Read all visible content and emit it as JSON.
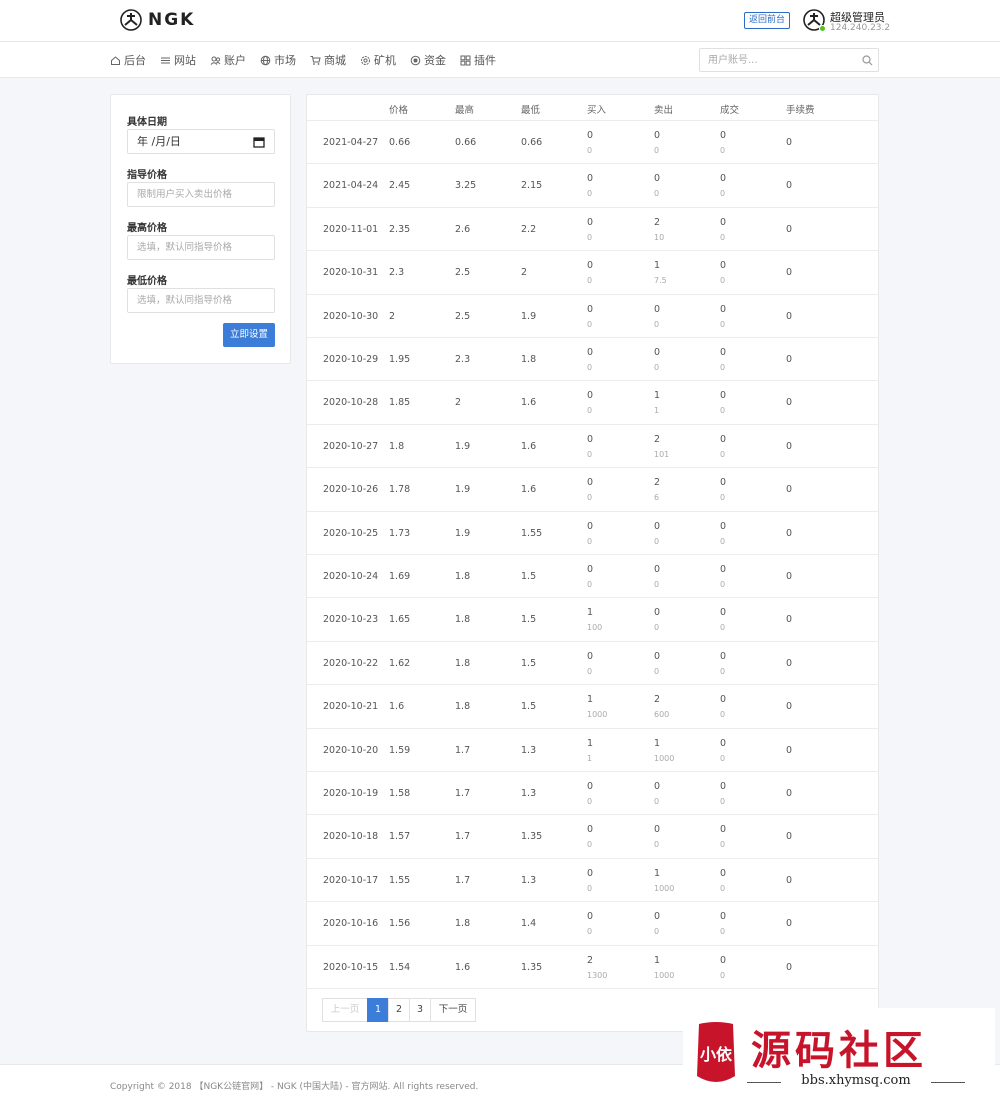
{
  "header": {
    "logo_text": "NGK",
    "back_label": "返回前台",
    "user_name": "超级管理员",
    "user_ip": "124.240.23.2"
  },
  "nav": {
    "items": [
      {
        "label": "后台",
        "icon": "home-icon"
      },
      {
        "label": "网站",
        "icon": "list-icon"
      },
      {
        "label": "账户",
        "icon": "users-icon"
      },
      {
        "label": "市场",
        "icon": "globe-icon"
      },
      {
        "label": "商城",
        "icon": "cart-icon"
      },
      {
        "label": "矿机",
        "icon": "gear-icon"
      },
      {
        "label": "资金",
        "icon": "coin-icon"
      },
      {
        "label": "插件",
        "icon": "grid-icon"
      }
    ],
    "search_placeholder": "用户账号..."
  },
  "form": {
    "date_label": "具体日期",
    "date_value": "年 /月/日",
    "guide_label": "指导价格",
    "guide_placeholder": "限制用户买入卖出价格",
    "max_label": "最高价格",
    "max_placeholder": "选填，默认同指导价格",
    "min_label": "最低价格",
    "min_placeholder": "选填，默认同指导价格",
    "submit_label": "立即设置"
  },
  "table": {
    "columns": [
      "价格",
      "最高",
      "最低",
      "买入",
      "卖出",
      "成交",
      "手续费"
    ],
    "rows": [
      {
        "date": "2021-04-27",
        "price": "0.66",
        "high": "0.66",
        "low": "0.66",
        "buy": "0",
        "buy_sub": "0",
        "sell": "0",
        "sell_sub": "0",
        "deal": "0",
        "deal_sub": "0",
        "fee": "0"
      },
      {
        "date": "2021-04-24",
        "price": "2.45",
        "high": "3.25",
        "low": "2.15",
        "buy": "0",
        "buy_sub": "0",
        "sell": "0",
        "sell_sub": "0",
        "deal": "0",
        "deal_sub": "0",
        "fee": "0"
      },
      {
        "date": "2020-11-01",
        "price": "2.35",
        "high": "2.6",
        "low": "2.2",
        "buy": "0",
        "buy_sub": "0",
        "sell": "2",
        "sell_sub": "10",
        "deal": "0",
        "deal_sub": "0",
        "fee": "0"
      },
      {
        "date": "2020-10-31",
        "price": "2.3",
        "high": "2.5",
        "low": "2",
        "buy": "0",
        "buy_sub": "0",
        "sell": "1",
        "sell_sub": "7.5",
        "deal": "0",
        "deal_sub": "0",
        "fee": "0"
      },
      {
        "date": "2020-10-30",
        "price": "2",
        "high": "2.5",
        "low": "1.9",
        "buy": "0",
        "buy_sub": "0",
        "sell": "0",
        "sell_sub": "0",
        "deal": "0",
        "deal_sub": "0",
        "fee": "0"
      },
      {
        "date": "2020-10-29",
        "price": "1.95",
        "high": "2.3",
        "low": "1.8",
        "buy": "0",
        "buy_sub": "0",
        "sell": "0",
        "sell_sub": "0",
        "deal": "0",
        "deal_sub": "0",
        "fee": "0"
      },
      {
        "date": "2020-10-28",
        "price": "1.85",
        "high": "2",
        "low": "1.6",
        "buy": "0",
        "buy_sub": "0",
        "sell": "1",
        "sell_sub": "1",
        "deal": "0",
        "deal_sub": "0",
        "fee": "0"
      },
      {
        "date": "2020-10-27",
        "price": "1.8",
        "high": "1.9",
        "low": "1.6",
        "buy": "0",
        "buy_sub": "0",
        "sell": "2",
        "sell_sub": "101",
        "deal": "0",
        "deal_sub": "0",
        "fee": "0"
      },
      {
        "date": "2020-10-26",
        "price": "1.78",
        "high": "1.9",
        "low": "1.6",
        "buy": "0",
        "buy_sub": "0",
        "sell": "2",
        "sell_sub": "6",
        "deal": "0",
        "deal_sub": "0",
        "fee": "0"
      },
      {
        "date": "2020-10-25",
        "price": "1.73",
        "high": "1.9",
        "low": "1.55",
        "buy": "0",
        "buy_sub": "0",
        "sell": "0",
        "sell_sub": "0",
        "deal": "0",
        "deal_sub": "0",
        "fee": "0"
      },
      {
        "date": "2020-10-24",
        "price": "1.69",
        "high": "1.8",
        "low": "1.5",
        "buy": "0",
        "buy_sub": "0",
        "sell": "0",
        "sell_sub": "0",
        "deal": "0",
        "deal_sub": "0",
        "fee": "0"
      },
      {
        "date": "2020-10-23",
        "price": "1.65",
        "high": "1.8",
        "low": "1.5",
        "buy": "1",
        "buy_sub": "100",
        "sell": "0",
        "sell_sub": "0",
        "deal": "0",
        "deal_sub": "0",
        "fee": "0"
      },
      {
        "date": "2020-10-22",
        "price": "1.62",
        "high": "1.8",
        "low": "1.5",
        "buy": "0",
        "buy_sub": "0",
        "sell": "0",
        "sell_sub": "0",
        "deal": "0",
        "deal_sub": "0",
        "fee": "0"
      },
      {
        "date": "2020-10-21",
        "price": "1.6",
        "high": "1.8",
        "low": "1.5",
        "buy": "1",
        "buy_sub": "1000",
        "sell": "2",
        "sell_sub": "600",
        "deal": "0",
        "deal_sub": "0",
        "fee": "0"
      },
      {
        "date": "2020-10-20",
        "price": "1.59",
        "high": "1.7",
        "low": "1.3",
        "buy": "1",
        "buy_sub": "1",
        "sell": "1",
        "sell_sub": "1000",
        "deal": "0",
        "deal_sub": "0",
        "fee": "0"
      },
      {
        "date": "2020-10-19",
        "price": "1.58",
        "high": "1.7",
        "low": "1.3",
        "buy": "0",
        "buy_sub": "0",
        "sell": "0",
        "sell_sub": "0",
        "deal": "0",
        "deal_sub": "0",
        "fee": "0"
      },
      {
        "date": "2020-10-18",
        "price": "1.57",
        "high": "1.7",
        "low": "1.35",
        "buy": "0",
        "buy_sub": "0",
        "sell": "0",
        "sell_sub": "0",
        "deal": "0",
        "deal_sub": "0",
        "fee": "0"
      },
      {
        "date": "2020-10-17",
        "price": "1.55",
        "high": "1.7",
        "low": "1.3",
        "buy": "0",
        "buy_sub": "0",
        "sell": "1",
        "sell_sub": "1000",
        "deal": "0",
        "deal_sub": "0",
        "fee": "0"
      },
      {
        "date": "2020-10-16",
        "price": "1.56",
        "high": "1.8",
        "low": "1.4",
        "buy": "0",
        "buy_sub": "0",
        "sell": "0",
        "sell_sub": "0",
        "deal": "0",
        "deal_sub": "0",
        "fee": "0"
      },
      {
        "date": "2020-10-15",
        "price": "1.54",
        "high": "1.6",
        "low": "1.35",
        "buy": "2",
        "buy_sub": "1300",
        "sell": "1",
        "sell_sub": "1000",
        "deal": "0",
        "deal_sub": "0",
        "fee": "0"
      }
    ]
  },
  "pagination": {
    "prev_label": "上一页",
    "pages": [
      "1",
      "2",
      "3"
    ],
    "current": "1",
    "next_label": "下一页"
  },
  "footer": {
    "copyright": "Copyright © 2018 【NGK公链官网】 - NGK (中国大陆) - 官方网站. All rights reserved."
  },
  "watermark": {
    "title": "源码社区",
    "url": "bbs.xhymsq.com",
    "badge_text": "小依"
  },
  "colors": {
    "accent": "#3b7dd8",
    "online": "#52c41a",
    "watermark_red": "#c8142a"
  }
}
